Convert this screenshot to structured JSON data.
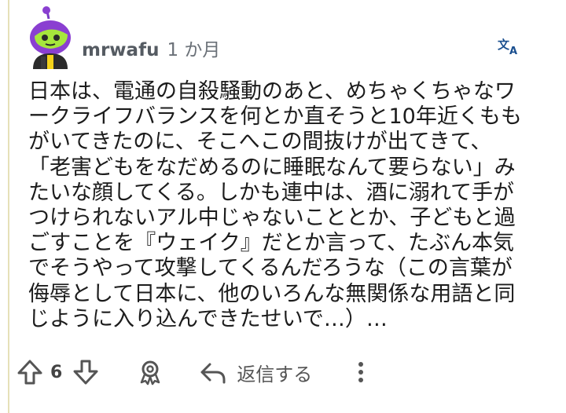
{
  "comment": {
    "author": "mrwafu",
    "time": "1 か月",
    "body_lines": [
      "日本は、電通の自殺騒動のあと、めちゃくちゃなワ",
      "ークライフバランスを何とか直そうと10年近くもも",
      "がいてきたのに、そこへこの間抜けが出てきて、",
      "「老害どもをなだめるのに睡眠なんて要らない」み",
      "たいな顔してくる。しかも連中は、酒に溺れて手が",
      "つけられないアル中じゃないこととか、子どもと過",
      "ごすことを『ウェイク』だとか言って、たぶん本気",
      "でそうやって攻撃してくるんだろうな（この言葉が",
      "侮辱として日本に、他のいろんな無関係な用語と同",
      "じように入り込んできたせいで…）…"
    ]
  },
  "actions": {
    "vote_count": "6",
    "reply_label": "返信する"
  },
  "icons": {
    "avatar": "snoo-avatar-icon",
    "translate": "translate-icon",
    "upvote": "upvote-arrow-icon",
    "downvote": "downvote-arrow-icon",
    "award": "award-icon",
    "reply": "reply-arrow-icon",
    "more": "more-options-icon"
  },
  "colors": {
    "thread_line": "#e6e0b8",
    "avatar_purple": "#8a3fd1",
    "avatar_green": "#a6e63c",
    "translate_blue": "#1a4f8f"
  }
}
